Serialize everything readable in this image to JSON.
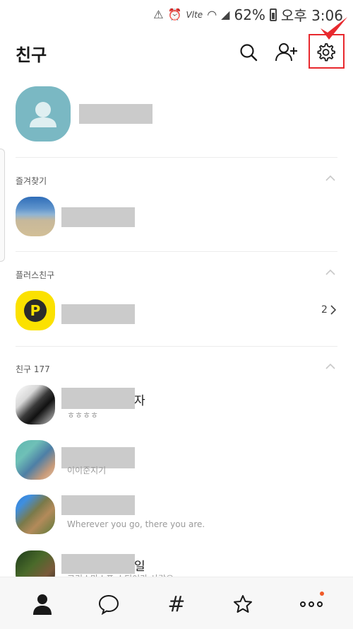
{
  "status_bar": {
    "battery": "62%",
    "time": "오후 3:06",
    "network": "Vlte"
  },
  "header": {
    "title": "친구"
  },
  "sections": {
    "favorites": "즐겨찾기",
    "plus_friends": "플러스친구",
    "friends": "친구 177"
  },
  "plus_friends": {
    "count": "2"
  },
  "friends": [
    {
      "name_suffix": "자",
      "status": "ㅎㅎㅎㅎ"
    },
    {
      "name_suffix": "",
      "status": "이이준지기"
    },
    {
      "name_suffix": "",
      "status": "Wherever you go, there you are."
    },
    {
      "name_suffix": "일",
      "status": "고리스마스프 스티이가 사랑요"
    }
  ],
  "icons": {
    "search": "search-icon",
    "add_friend": "add-friend-icon",
    "settings": "gear-icon",
    "nav_friends": "person-icon",
    "nav_chats": "chat-bubble-icon",
    "nav_openchat": "hash-icon",
    "nav_view": "star-icon",
    "nav_more": "more-icon"
  },
  "colors": {
    "highlight": "#e8292e",
    "plus_yellow": "#fbe100",
    "my_avatar": "#7ab8c3",
    "new_dot": "#f05a28"
  }
}
